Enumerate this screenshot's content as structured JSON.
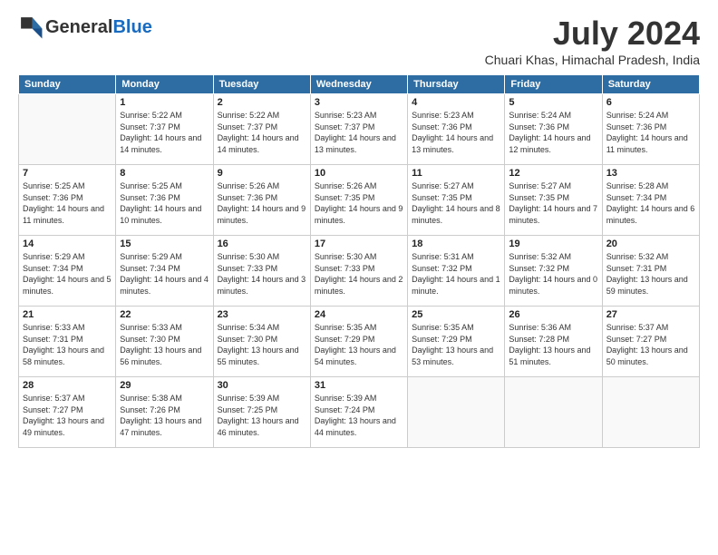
{
  "header": {
    "logo_general": "General",
    "logo_blue": "Blue",
    "month_title": "July 2024",
    "subtitle": "Chuari Khas, Himachal Pradesh, India"
  },
  "days_of_week": [
    "Sunday",
    "Monday",
    "Tuesday",
    "Wednesday",
    "Thursday",
    "Friday",
    "Saturday"
  ],
  "weeks": [
    [
      {
        "day": "",
        "info": ""
      },
      {
        "day": "1",
        "info": "Sunrise: 5:22 AM\nSunset: 7:37 PM\nDaylight: 14 hours\nand 14 minutes."
      },
      {
        "day": "2",
        "info": "Sunrise: 5:22 AM\nSunset: 7:37 PM\nDaylight: 14 hours\nand 14 minutes."
      },
      {
        "day": "3",
        "info": "Sunrise: 5:23 AM\nSunset: 7:37 PM\nDaylight: 14 hours\nand 13 minutes."
      },
      {
        "day": "4",
        "info": "Sunrise: 5:23 AM\nSunset: 7:36 PM\nDaylight: 14 hours\nand 13 minutes."
      },
      {
        "day": "5",
        "info": "Sunrise: 5:24 AM\nSunset: 7:36 PM\nDaylight: 14 hours\nand 12 minutes."
      },
      {
        "day": "6",
        "info": "Sunrise: 5:24 AM\nSunset: 7:36 PM\nDaylight: 14 hours\nand 11 minutes."
      }
    ],
    [
      {
        "day": "7",
        "info": "Sunrise: 5:25 AM\nSunset: 7:36 PM\nDaylight: 14 hours\nand 11 minutes."
      },
      {
        "day": "8",
        "info": "Sunrise: 5:25 AM\nSunset: 7:36 PM\nDaylight: 14 hours\nand 10 minutes."
      },
      {
        "day": "9",
        "info": "Sunrise: 5:26 AM\nSunset: 7:36 PM\nDaylight: 14 hours\nand 9 minutes."
      },
      {
        "day": "10",
        "info": "Sunrise: 5:26 AM\nSunset: 7:35 PM\nDaylight: 14 hours\nand 9 minutes."
      },
      {
        "day": "11",
        "info": "Sunrise: 5:27 AM\nSunset: 7:35 PM\nDaylight: 14 hours\nand 8 minutes."
      },
      {
        "day": "12",
        "info": "Sunrise: 5:27 AM\nSunset: 7:35 PM\nDaylight: 14 hours\nand 7 minutes."
      },
      {
        "day": "13",
        "info": "Sunrise: 5:28 AM\nSunset: 7:34 PM\nDaylight: 14 hours\nand 6 minutes."
      }
    ],
    [
      {
        "day": "14",
        "info": "Sunrise: 5:29 AM\nSunset: 7:34 PM\nDaylight: 14 hours\nand 5 minutes."
      },
      {
        "day": "15",
        "info": "Sunrise: 5:29 AM\nSunset: 7:34 PM\nDaylight: 14 hours\nand 4 minutes."
      },
      {
        "day": "16",
        "info": "Sunrise: 5:30 AM\nSunset: 7:33 PM\nDaylight: 14 hours\nand 3 minutes."
      },
      {
        "day": "17",
        "info": "Sunrise: 5:30 AM\nSunset: 7:33 PM\nDaylight: 14 hours\nand 2 minutes."
      },
      {
        "day": "18",
        "info": "Sunrise: 5:31 AM\nSunset: 7:32 PM\nDaylight: 14 hours\nand 1 minute."
      },
      {
        "day": "19",
        "info": "Sunrise: 5:32 AM\nSunset: 7:32 PM\nDaylight: 14 hours\nand 0 minutes."
      },
      {
        "day": "20",
        "info": "Sunrise: 5:32 AM\nSunset: 7:31 PM\nDaylight: 13 hours\nand 59 minutes."
      }
    ],
    [
      {
        "day": "21",
        "info": "Sunrise: 5:33 AM\nSunset: 7:31 PM\nDaylight: 13 hours\nand 58 minutes."
      },
      {
        "day": "22",
        "info": "Sunrise: 5:33 AM\nSunset: 7:30 PM\nDaylight: 13 hours\nand 56 minutes."
      },
      {
        "day": "23",
        "info": "Sunrise: 5:34 AM\nSunset: 7:30 PM\nDaylight: 13 hours\nand 55 minutes."
      },
      {
        "day": "24",
        "info": "Sunrise: 5:35 AM\nSunset: 7:29 PM\nDaylight: 13 hours\nand 54 minutes."
      },
      {
        "day": "25",
        "info": "Sunrise: 5:35 AM\nSunset: 7:29 PM\nDaylight: 13 hours\nand 53 minutes."
      },
      {
        "day": "26",
        "info": "Sunrise: 5:36 AM\nSunset: 7:28 PM\nDaylight: 13 hours\nand 51 minutes."
      },
      {
        "day": "27",
        "info": "Sunrise: 5:37 AM\nSunset: 7:27 PM\nDaylight: 13 hours\nand 50 minutes."
      }
    ],
    [
      {
        "day": "28",
        "info": "Sunrise: 5:37 AM\nSunset: 7:27 PM\nDaylight: 13 hours\nand 49 minutes."
      },
      {
        "day": "29",
        "info": "Sunrise: 5:38 AM\nSunset: 7:26 PM\nDaylight: 13 hours\nand 47 minutes."
      },
      {
        "day": "30",
        "info": "Sunrise: 5:39 AM\nSunset: 7:25 PM\nDaylight: 13 hours\nand 46 minutes."
      },
      {
        "day": "31",
        "info": "Sunrise: 5:39 AM\nSunset: 7:24 PM\nDaylight: 13 hours\nand 44 minutes."
      },
      {
        "day": "",
        "info": ""
      },
      {
        "day": "",
        "info": ""
      },
      {
        "day": "",
        "info": ""
      }
    ]
  ]
}
